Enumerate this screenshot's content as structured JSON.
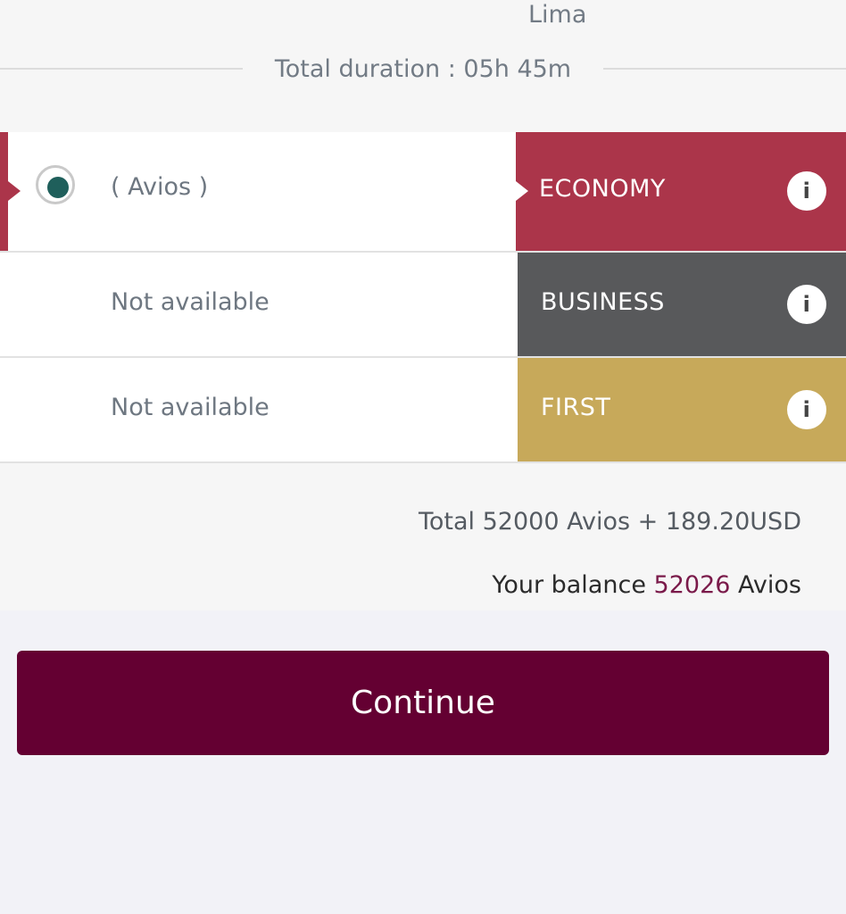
{
  "flight": {
    "arrival_city": "Lima",
    "total_duration": "Total duration : 05h 45m"
  },
  "fares": [
    {
      "text": "( Avios )",
      "cabin": "ECONOMY",
      "selected": true
    },
    {
      "text": "Not available",
      "cabin": "BUSINESS",
      "selected": false
    },
    {
      "text": "Not available",
      "cabin": "FIRST",
      "selected": false
    }
  ],
  "info_icon": "i",
  "summary": {
    "total": "Total 52000 Avios + 189.20USD",
    "balance_prefix": "Your balance",
    "balance_value": "52026",
    "balance_suffix": "Avios"
  },
  "continue_label": "Continue",
  "colors": {
    "economy": "#ab354a",
    "business": "#58595b",
    "first": "#c7a95a",
    "continue_button": "#640032",
    "radio_selected": "#1f5f5b",
    "balance_value": "#7a1a4a"
  },
  "icons": [
    "info-icon",
    "radio-selected-icon"
  ]
}
